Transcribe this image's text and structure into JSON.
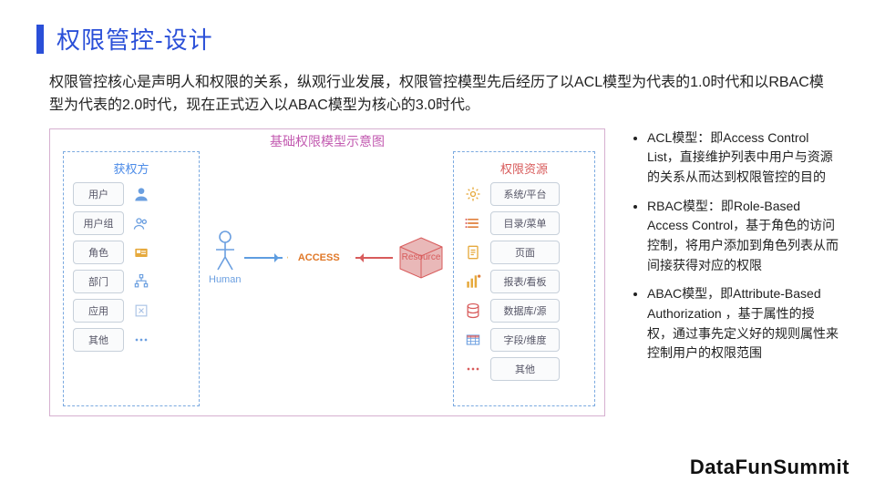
{
  "title": "权限管控-设计",
  "intro": "权限管控核心是声明人和权限的关系，纵观行业发展，权限管控模型先后经历了以ACL模型为代表的1.0时代和以RBAC模型为代表的2.0时代，现在正式迈入以ABAC模型为核心的3.0时代。",
  "diagram": {
    "title": "基础权限模型示意图",
    "left_title": "获权方",
    "right_title": "权限资源",
    "left_items": [
      "用户",
      "用户组",
      "角色",
      "部门",
      "应用",
      "其他"
    ],
    "right_items": [
      "系统/平台",
      "目录/菜单",
      "页面",
      "报表/看板",
      "数据库/源",
      "字段/维度",
      "其他"
    ],
    "human_label": "Human",
    "hex_label": "ACCESS",
    "cube_label": "Resource"
  },
  "bullets": [
    "ACL模型：即Access Control List，直接维护列表中用户与资源的关系从而达到权限管控的目的",
    "RBAC模型：即Role-Based Access Control，基于角色的访问控制，将用户添加到角色列表从而间接获得对应的权限",
    "ABAC模型，即Attribute-Based Authorization ，基于属性的授权，通过事先定义好的规则属性来控制用户的权限范围"
  ],
  "footer": "DataFunSummit",
  "colors": {
    "accent": "#2a4fd8",
    "orange": "#e6a93c",
    "red": "#d85b5b",
    "blue": "#5e9de0",
    "purple": "#c25ab0"
  }
}
